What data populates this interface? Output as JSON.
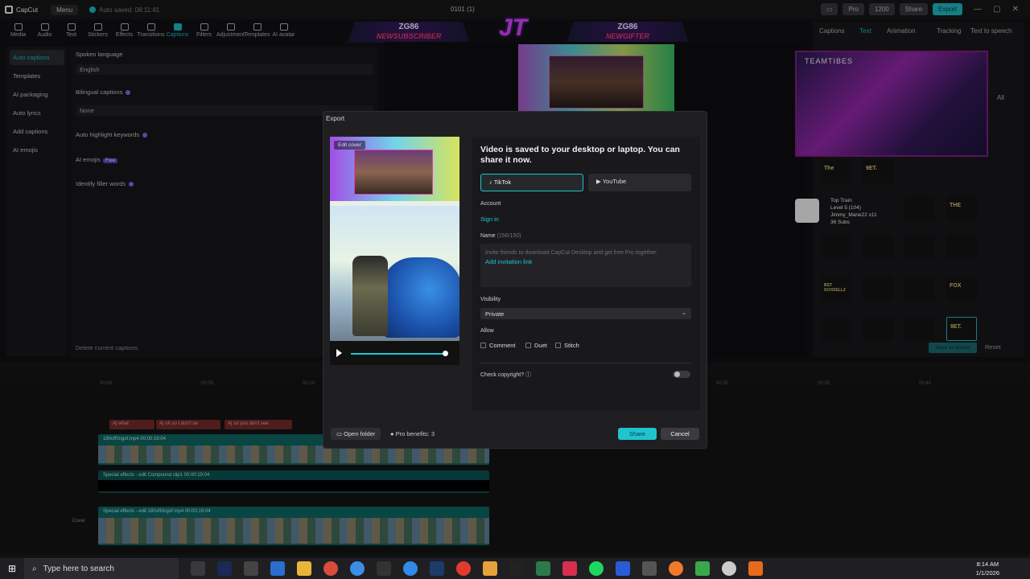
{
  "app": {
    "autosave": "Auto saved: 08:11:41",
    "menu": "Menu",
    "window_title": "0101 (1)",
    "logo": "CapCut",
    "pro": "Pro",
    "credits": "1200",
    "share": "Share",
    "export": "Export"
  },
  "toolbar": [
    "Media",
    "Audio",
    "Text",
    "Stickers",
    "Effects",
    "Transitions",
    "Captions",
    "Filters",
    "Adjustment",
    "Templates",
    "AI avatar"
  ],
  "banners": {
    "left": {
      "name": "ZG86",
      "tag": "NEWSUBSCRIBER"
    },
    "right": {
      "name": "ZG86",
      "tag": "NEWGIFTER"
    },
    "logo": "JT"
  },
  "leftnav": [
    "Auto captions",
    "Templates",
    "AI packaging",
    "Auto lyrics",
    "Add captions",
    "AI emojis"
  ],
  "captions": {
    "spoken_language_label": "Spoken language",
    "spoken_language": "English",
    "bilingual_label": "Bilingual captions",
    "bilingual_value": "None",
    "highlight_label": "Auto highlight keywords",
    "emojis_label": "AI emojis",
    "emojis_badge": "Free",
    "filler_label": "Identify filler words",
    "delete_label": "Delete current captions"
  },
  "right_tabs": [
    "Captions",
    "Text",
    "Animation",
    "Tracking",
    "Text to speech"
  ],
  "right_panel": {
    "webcam_label": "TEAMTIBES",
    "all": "All",
    "tiles": [
      "The",
      "9ET.",
      "THE",
      "THE",
      "BST SCHOELLZ",
      "FOX",
      "9ET."
    ],
    "train": [
      "Top Train",
      "Level 5 (104)",
      "Jimmy_Mane22 x11",
      "36 Subs"
    ],
    "save_preset": "Save as preset",
    "reset": "Reset"
  },
  "timeline": {
    "ruler": [
      "00:00",
      "00:05",
      "00:10",
      "00:30",
      "00:35",
      "00:40"
    ],
    "captions": [
      "A| what",
      "A| oh so I don't se",
      "A| so you don't see"
    ],
    "clip1": "180off/ingof.mp4  00:00:19:04",
    "clip2": "Special effects - edit  Compound clip1  00:00:19:04",
    "clip3": "Special effects - edit  180off/ingof.mp4  00:00:19:04",
    "cover": "Cover"
  },
  "dialog": {
    "title": "Export",
    "edit_cover": "Edit cover",
    "headline": "Video is saved to your desktop or laptop. You can share it now.",
    "tiktok": "TikTok",
    "youtube": "YouTube",
    "account_label": "Account",
    "sign_in": "Sign in",
    "name_label": "Name",
    "name_count": "(156/150)",
    "name_placeholder": "Invite friends to download CapCut Desktop and get free Pro together.",
    "invite_link": "Add invitation link",
    "visibility_label": "Visibility",
    "visibility": "Private",
    "allow_label": "Allow",
    "allow": [
      "Comment",
      "Duet",
      "Stitch"
    ],
    "copyright_label": "Check copyright?",
    "open_folder": "Open folder",
    "pro_benefits": "Pro benefits: 3",
    "share_btn": "Share",
    "cancel": "Cancel"
  },
  "taskbar": {
    "search": "Type here to search",
    "time": "8:14 AM",
    "date": "1/1/2026"
  }
}
